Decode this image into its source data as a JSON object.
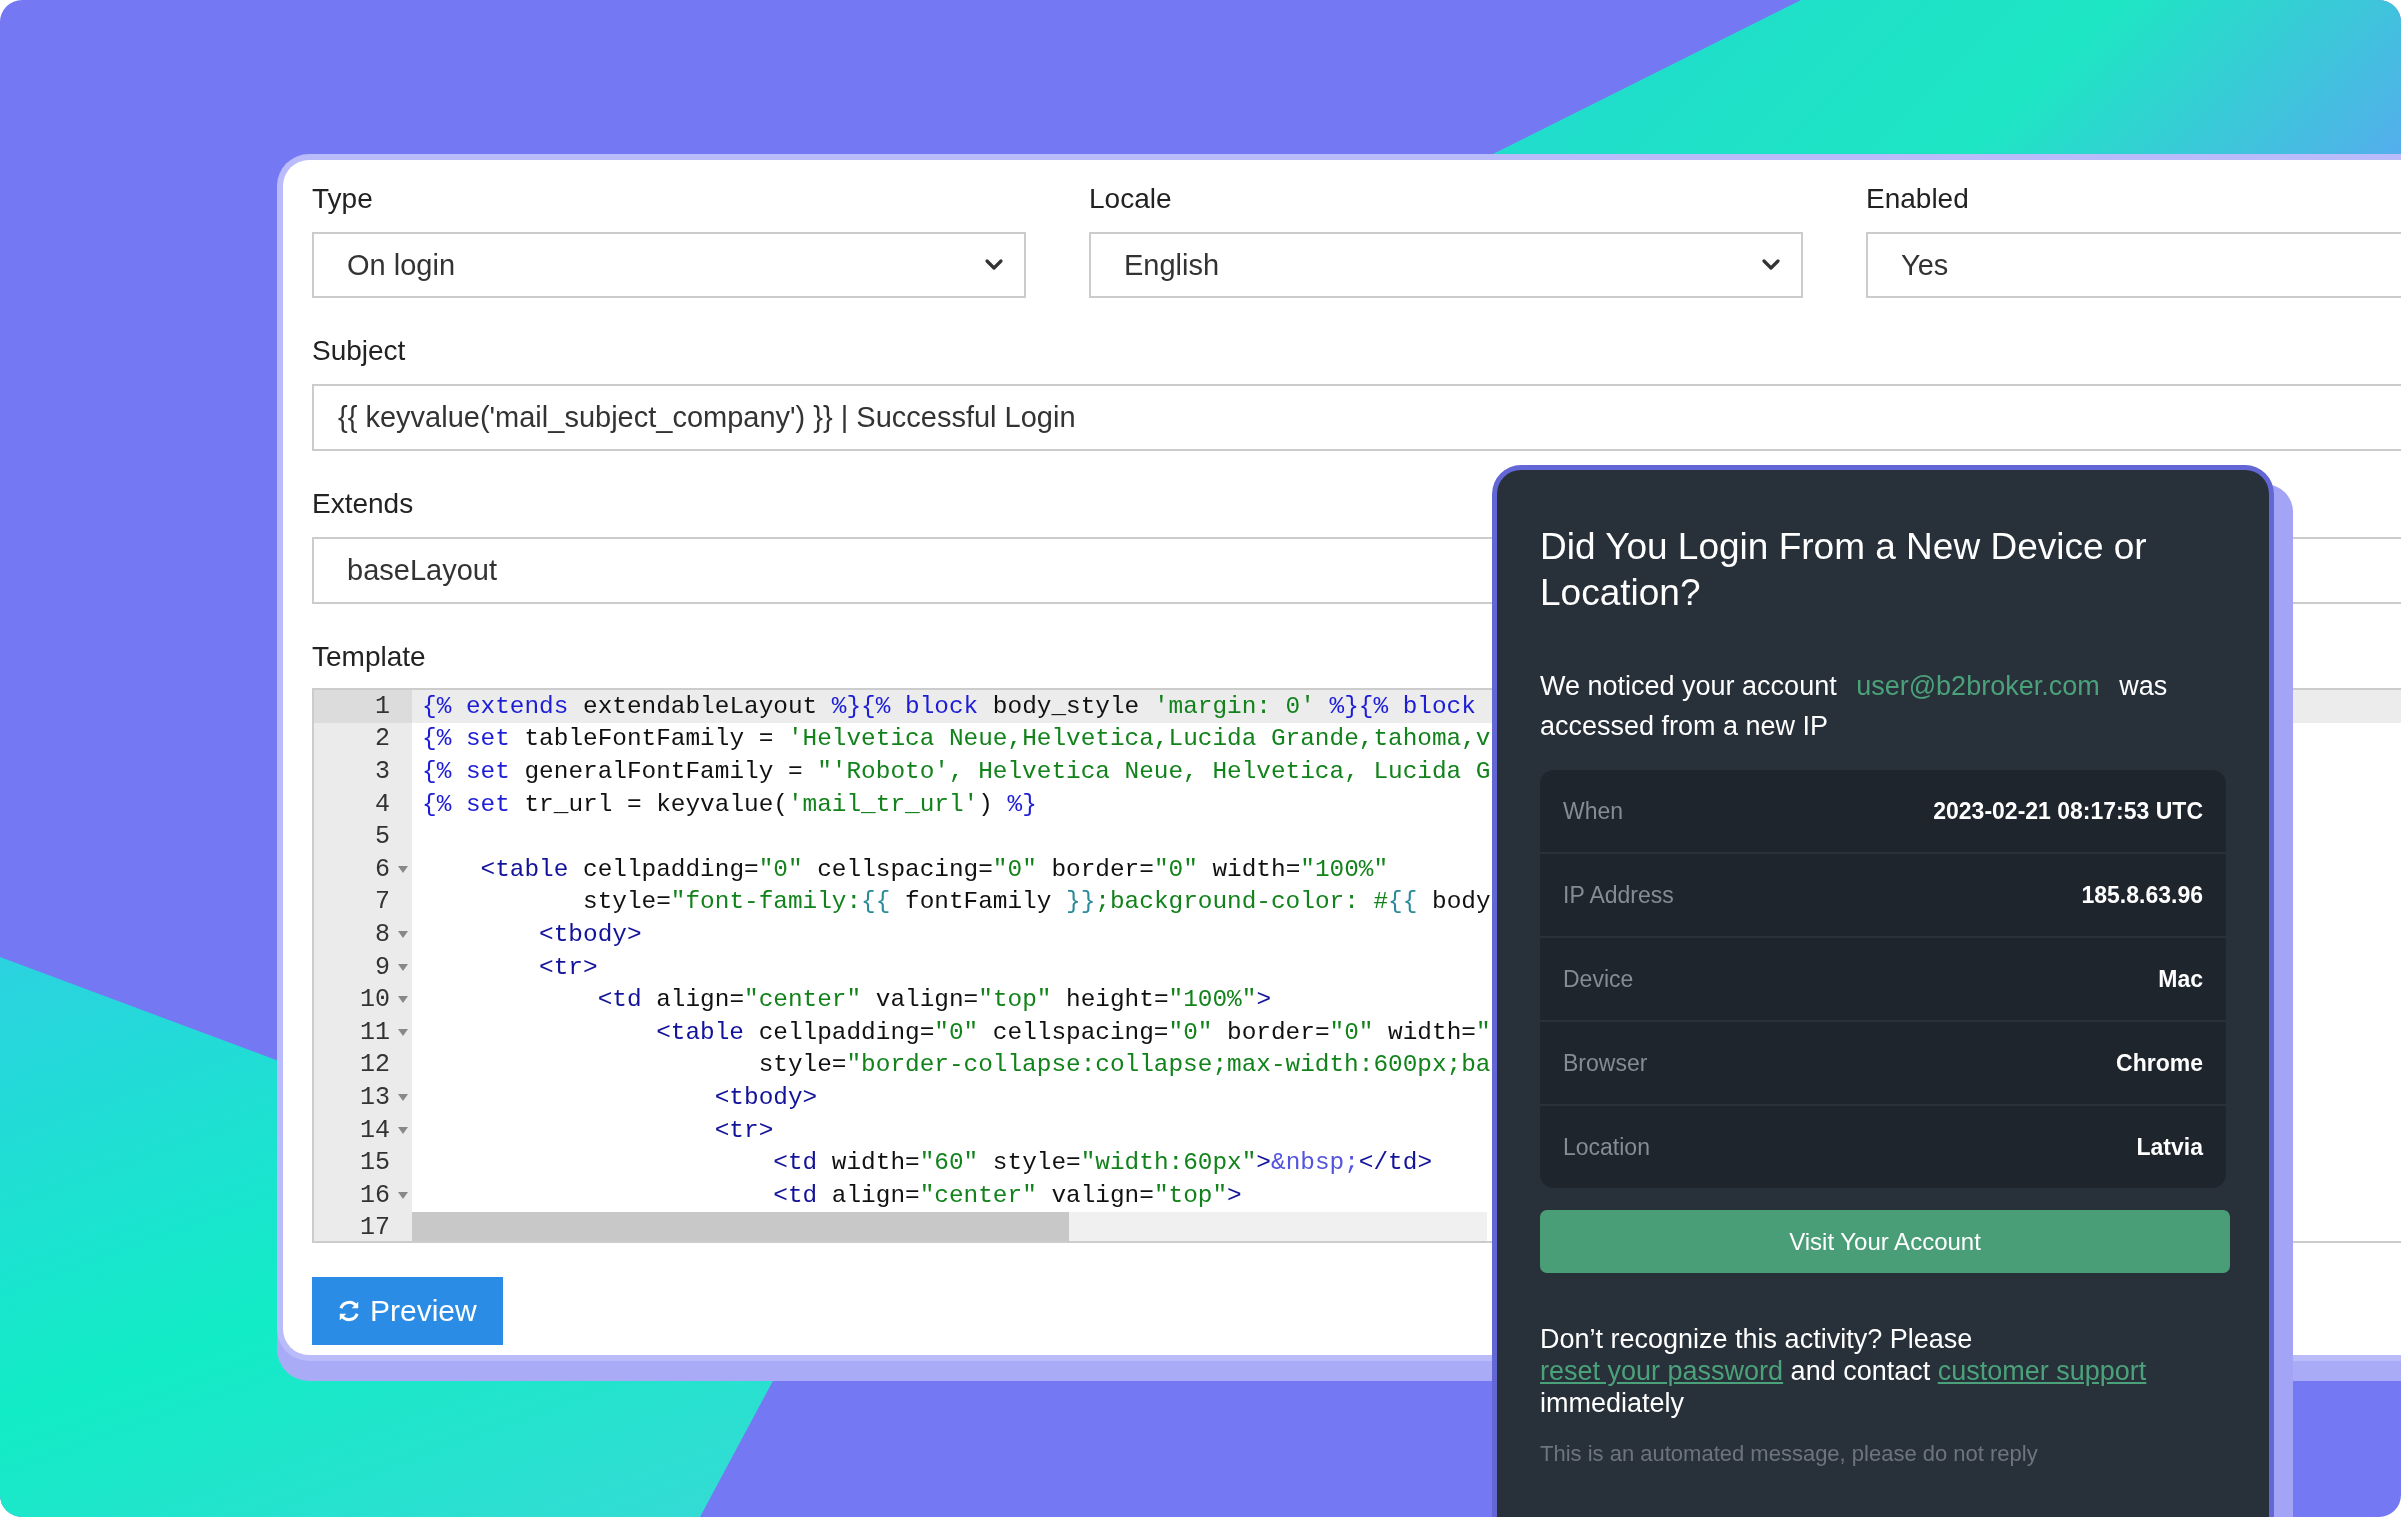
{
  "form": {
    "selects": [
      {
        "label": "Type",
        "value": "On login"
      },
      {
        "label": "Locale",
        "value": "English"
      },
      {
        "label": "Enabled",
        "value": "Yes"
      }
    ],
    "subject": {
      "label": "Subject",
      "value": "{{ keyvalue('mail_subject_company') }} | Successful Login"
    },
    "extends": {
      "label": "Extends",
      "value": "baseLayout"
    },
    "template": {
      "label": "Template",
      "lines": [
        {
          "number": "1",
          "active": true,
          "foldable": false,
          "tokens": [
            {
              "kind": "keyword",
              "text": "{% extends"
            },
            {
              "kind": "text",
              "text": " extendableLayout "
            },
            {
              "kind": "keyword",
              "text": "%}{% block"
            },
            {
              "kind": "text",
              "text": " body_style "
            },
            {
              "kind": "string",
              "text": "'margin: 0'"
            },
            {
              "kind": "keyword",
              "text": " %}{% block"
            }
          ]
        },
        {
          "number": "2",
          "active": false,
          "foldable": false,
          "tokens": [
            {
              "kind": "keyword",
              "text": "{% set"
            },
            {
              "kind": "text",
              "text": " tableFontFamily = "
            },
            {
              "kind": "string",
              "text": "'Helvetica Neue,Helvetica,Lucida Grande,tahoma,v"
            }
          ]
        },
        {
          "number": "3",
          "active": false,
          "foldable": false,
          "tokens": [
            {
              "kind": "keyword",
              "text": "{% set"
            },
            {
              "kind": "text",
              "text": " generalFontFamily = "
            },
            {
              "kind": "string",
              "text": "\"'Roboto', Helvetica Neue, Helvetica, Lucida G"
            }
          ]
        },
        {
          "number": "4",
          "active": false,
          "foldable": false,
          "tokens": [
            {
              "kind": "keyword",
              "text": "{% set"
            },
            {
              "kind": "text",
              "text": " tr_url = keyvalue("
            },
            {
              "kind": "string",
              "text": "'mail_tr_url'"
            },
            {
              "kind": "text",
              "text": ") "
            },
            {
              "kind": "keyword",
              "text": "%}"
            }
          ]
        },
        {
          "number": "5",
          "active": false,
          "foldable": false
        },
        {
          "number": "6",
          "active": false,
          "foldable": true,
          "tokens": [
            {
              "kind": "tag",
              "text": "    <table"
            },
            {
              "kind": "text",
              "text": " cellpadding="
            },
            {
              "kind": "string",
              "text": "\"0\""
            },
            {
              "kind": "text",
              "text": " cellspacing="
            },
            {
              "kind": "string",
              "text": "\"0\""
            },
            {
              "kind": "text",
              "text": " border="
            },
            {
              "kind": "string",
              "text": "\"0\""
            },
            {
              "kind": "text",
              "text": " width="
            },
            {
              "kind": "string",
              "text": "\"100%\""
            }
          ]
        },
        {
          "number": "7",
          "active": false,
          "foldable": false,
          "tokens": [
            {
              "kind": "text",
              "text": "           style="
            },
            {
              "kind": "string",
              "text": "\"font-family:"
            },
            {
              "kind": "brace",
              "text": "{{"
            },
            {
              "kind": "text",
              "text": " fontFamily "
            },
            {
              "kind": "brace",
              "text": "}}"
            },
            {
              "kind": "string",
              "text": ";background-color: #"
            },
            {
              "kind": "brace",
              "text": "{{"
            },
            {
              "kind": "text",
              "text": " body"
            }
          ]
        },
        {
          "number": "8",
          "active": false,
          "foldable": true,
          "tokens": [
            {
              "kind": "tag",
              "text": "        <tbody>"
            }
          ]
        },
        {
          "number": "9",
          "active": false,
          "foldable": true,
          "tokens": [
            {
              "kind": "tag",
              "text": "        <tr>"
            }
          ]
        },
        {
          "number": "10",
          "active": false,
          "foldable": true,
          "tokens": [
            {
              "kind": "tag",
              "text": "            <td"
            },
            {
              "kind": "text",
              "text": " align="
            },
            {
              "kind": "string",
              "text": "\"center\""
            },
            {
              "kind": "text",
              "text": " valign="
            },
            {
              "kind": "string",
              "text": "\"top\""
            },
            {
              "kind": "text",
              "text": " height="
            },
            {
              "kind": "string",
              "text": "\"100%\""
            },
            {
              "kind": "tag",
              "text": ">"
            }
          ]
        },
        {
          "number": "11",
          "active": false,
          "foldable": true,
          "tokens": [
            {
              "kind": "tag",
              "text": "                <table"
            },
            {
              "kind": "text",
              "text": " cellpadding="
            },
            {
              "kind": "string",
              "text": "\"0\""
            },
            {
              "kind": "text",
              "text": " cellspacing="
            },
            {
              "kind": "string",
              "text": "\"0\""
            },
            {
              "kind": "text",
              "text": " border="
            },
            {
              "kind": "string",
              "text": "\"0\""
            },
            {
              "kind": "text",
              "text": " width="
            },
            {
              "kind": "string",
              "text": "\""
            }
          ]
        },
        {
          "number": "12",
          "active": false,
          "foldable": false,
          "tokens": [
            {
              "kind": "text",
              "text": "                       style="
            },
            {
              "kind": "string",
              "text": "\"border-collapse:collapse;max-width:600px;ba"
            }
          ]
        },
        {
          "number": "13",
          "active": false,
          "foldable": true,
          "tokens": [
            {
              "kind": "tag",
              "text": "                    <tbody>"
            }
          ]
        },
        {
          "number": "14",
          "active": false,
          "foldable": true,
          "tokens": [
            {
              "kind": "tag",
              "text": "                    <tr>"
            }
          ]
        },
        {
          "number": "15",
          "active": false,
          "foldable": false,
          "tokens": [
            {
              "kind": "tag",
              "text": "                        <td"
            },
            {
              "kind": "text",
              "text": " width="
            },
            {
              "kind": "string",
              "text": "\"60\""
            },
            {
              "kind": "text",
              "text": " style="
            },
            {
              "kind": "string",
              "text": "\"width:60px\""
            },
            {
              "kind": "tag",
              "text": ">"
            },
            {
              "kind": "entity",
              "text": "&nbsp;"
            },
            {
              "kind": "tag",
              "text": "</td>"
            }
          ]
        },
        {
          "number": "16",
          "active": false,
          "foldable": true,
          "tokens": [
            {
              "kind": "tag",
              "text": "                        <td"
            },
            {
              "kind": "text",
              "text": " align="
            },
            {
              "kind": "string",
              "text": "\"center\""
            },
            {
              "kind": "text",
              "text": " valign="
            },
            {
              "kind": "string",
              "text": "\"top\""
            },
            {
              "kind": "tag",
              "text": ">"
            }
          ]
        },
        {
          "number": "17",
          "active": false,
          "foldable": false
        }
      ]
    },
    "preview_button": "Preview"
  },
  "email_preview": {
    "title": "Did You Login From a New Device or Location?",
    "intro": {
      "before": "We noticed your account",
      "email": "user@b2broker.com",
      "after": "was accessed from a new IP"
    },
    "details": [
      {
        "label": "When",
        "value": "2023-02-21 08:17:53 UTC"
      },
      {
        "label": "IP Address",
        "value": "185.8.63.96"
      },
      {
        "label": "Device",
        "value": "Mac"
      },
      {
        "label": "Browser",
        "value": "Chrome"
      },
      {
        "label": "Location",
        "value": "Latvia"
      }
    ],
    "button": "Visit Your Account",
    "warning": {
      "before": "Don’t recognize this activity? Please",
      "link1": "reset your password",
      "middle": "and contact",
      "link2": "customer support",
      "after": "immediately"
    },
    "footer": "This is an automated message, please do not reply"
  }
}
